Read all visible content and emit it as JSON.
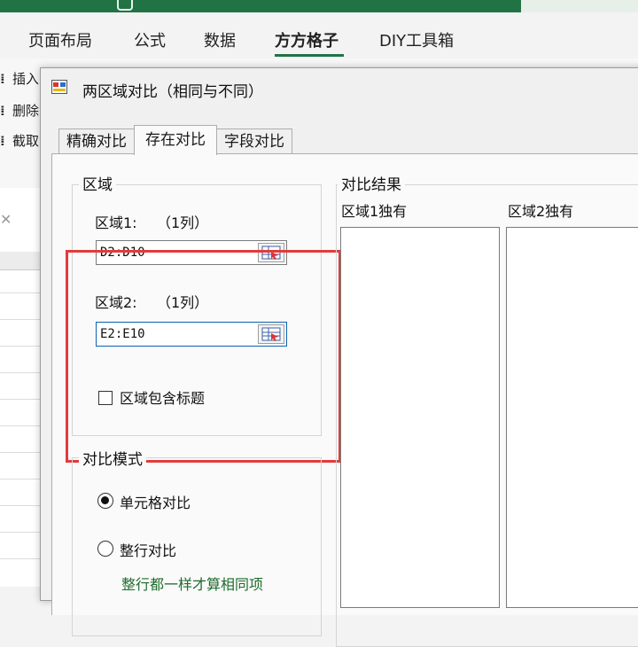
{
  "ribbon": {
    "tabs": [
      "页面布局",
      "公式",
      "数据",
      "方方格子",
      "DIY工具箱"
    ],
    "active_tab": "方方格子",
    "items": [
      "插入",
      "删除",
      "截取"
    ],
    "accent": "#217346"
  },
  "dialog": {
    "title": "两区域对比（相同与不同）",
    "tabs": [
      "精确对比",
      "存在对比",
      "字段对比"
    ],
    "selected_tab": "存在对比",
    "area_group": {
      "label": "区域",
      "range1_label": "区域1:",
      "range1_count": "（1列）",
      "range1_value": "D2:D10",
      "range2_label": "区域2:",
      "range2_count": "（1列）",
      "range2_value": "E2:E10",
      "include_header_label": "区域包含标题",
      "include_header_checked": false
    },
    "mode_group": {
      "label": "对比模式",
      "options": [
        "单元格对比",
        "整行对比"
      ],
      "selected": "单元格对比",
      "note": "整行都一样才算相同项"
    },
    "result_group": {
      "label": "对比结果",
      "col1": "区域1独有",
      "col2": "区域2独有"
    },
    "highlight_color": "#e23b3b"
  }
}
